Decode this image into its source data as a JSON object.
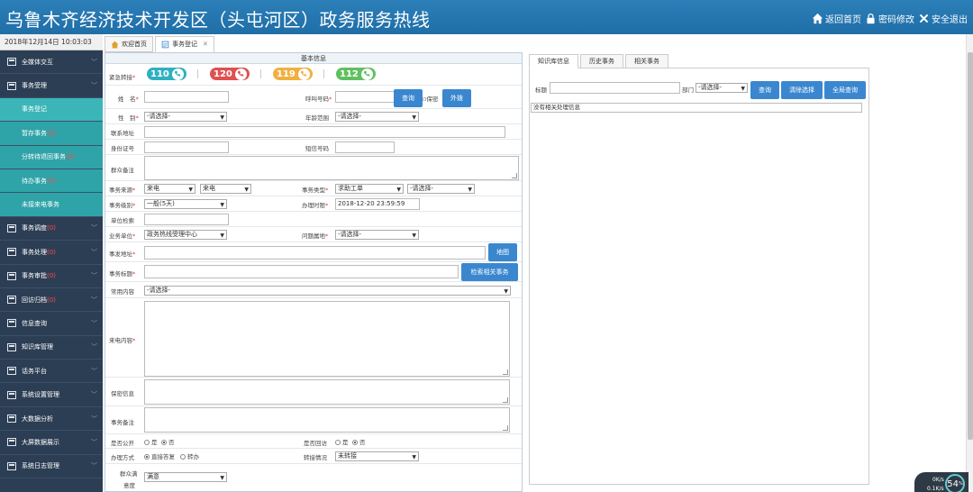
{
  "header": {
    "title": "乌鲁木齐经济技术开发区（头屯河区）政务服务热线",
    "links": [
      "返回首页",
      "密码修改",
      "安全退出"
    ]
  },
  "sidebar": {
    "date": "2018年12月14日 10:03:03",
    "items": [
      {
        "label": "全媒体交互",
        "badge": ""
      },
      {
        "label": "事务受理",
        "badge": ""
      },
      {
        "label": "事务登记",
        "badge": "",
        "sub": true,
        "active": true
      },
      {
        "label": "暂存事务",
        "badge": "(0)",
        "sub": true
      },
      {
        "label": "分转待退回事务",
        "badge": "(0)",
        "sub": true
      },
      {
        "label": "待办事务",
        "badge": "(0)",
        "sub": true
      },
      {
        "label": "未接来电事务",
        "badge": "",
        "sub": true
      },
      {
        "label": "事务调度",
        "badge": "(0)"
      },
      {
        "label": "事务处理",
        "badge": "(0)"
      },
      {
        "label": "事务审批",
        "badge": "(0)"
      },
      {
        "label": "回访归档",
        "badge": "(0)"
      },
      {
        "label": "信息查询",
        "badge": ""
      },
      {
        "label": "知识库管理",
        "badge": ""
      },
      {
        "label": "话务平台",
        "badge": ""
      },
      {
        "label": "系统设置管理",
        "badge": ""
      },
      {
        "label": "大数据分析",
        "badge": ""
      },
      {
        "label": "大屏数据展示",
        "badge": ""
      },
      {
        "label": "系统日志管理",
        "badge": ""
      }
    ]
  },
  "tabs": [
    {
      "label": "欢迎首页",
      "closable": false
    },
    {
      "label": "事务登记",
      "closable": true
    }
  ],
  "form": {
    "heading": "基本信息",
    "emergency_label": "紧急转接",
    "hotlines": [
      {
        "num": "110",
        "color": "#2fb0c0"
      },
      {
        "num": "120",
        "color": "#e05050"
      },
      {
        "num": "119",
        "color": "#f0b040"
      },
      {
        "num": "112",
        "color": "#60c060"
      }
    ],
    "name_label": "姓　名",
    "caller_label": "呼叫号码",
    "query_btn": "查询",
    "secret_label": "保密",
    "dialout_btn": "外拨",
    "gender_label": "性　别",
    "gender_value": "-请选择-",
    "age_label": "年龄范围",
    "age_value": "-请选择-",
    "address_label": "联系地址",
    "id_label": "身份证号",
    "sms_label": "短信号码",
    "remark_label": "群众备注",
    "source_label": "事务来源",
    "source_value1": "来电",
    "source_value2": "来电",
    "type_label": "事务类型",
    "type_value1": "求助工单",
    "type_value2": "-请选择-",
    "level_label": "事务级别",
    "level_value": "一般(5天)",
    "deadline_label": "办理时限",
    "deadline_value": "2018-12-20 23:59:59",
    "unit_search_label": "单位检索",
    "unit_label": "业务单位",
    "unit_value": "政务热线受理中心",
    "area_label": "问题属地",
    "area_value": "-请选择-",
    "location_label": "事发地址",
    "map_btn": "地图",
    "subject_label": "事务标题",
    "search_related_btn": "检索相关事务",
    "common_label": "常用内容",
    "common_value": "-请选择-",
    "content_label": "来电内容",
    "secret_info_label": "保密信息",
    "note_label": "事务备注",
    "public_label": "是否公开",
    "yes": "是",
    "no": "否",
    "feedback_label": "是否回访",
    "handle_label": "办理方式",
    "handle_opt1": "直接答复",
    "handle_opt2": "转办",
    "transfer_label": "转接情况",
    "transfer_value": "未转接",
    "satisfaction_label1": "群众满",
    "satisfaction_label2": "意度",
    "satisfaction_value": "满意"
  },
  "right": {
    "tabs": [
      "知识库信息",
      "历史事务",
      "相关事务"
    ],
    "title_label": "标题",
    "dept_label": "部门",
    "dept_value": "-请选择-",
    "query_btn": "查询",
    "clear_btn": "清除选择",
    "global_btn": "全局查询",
    "empty_msg": "没有相关处理信息"
  },
  "widget": {
    "pct": "54",
    "unit": "%",
    "up": "0K/s",
    "down": "0.1K/s"
  },
  "colors": {
    "header": "#2c7fb8",
    "sidebar": "#2c3e54",
    "sub_active": "#3cb5b9",
    "button": "#3a87cf"
  }
}
